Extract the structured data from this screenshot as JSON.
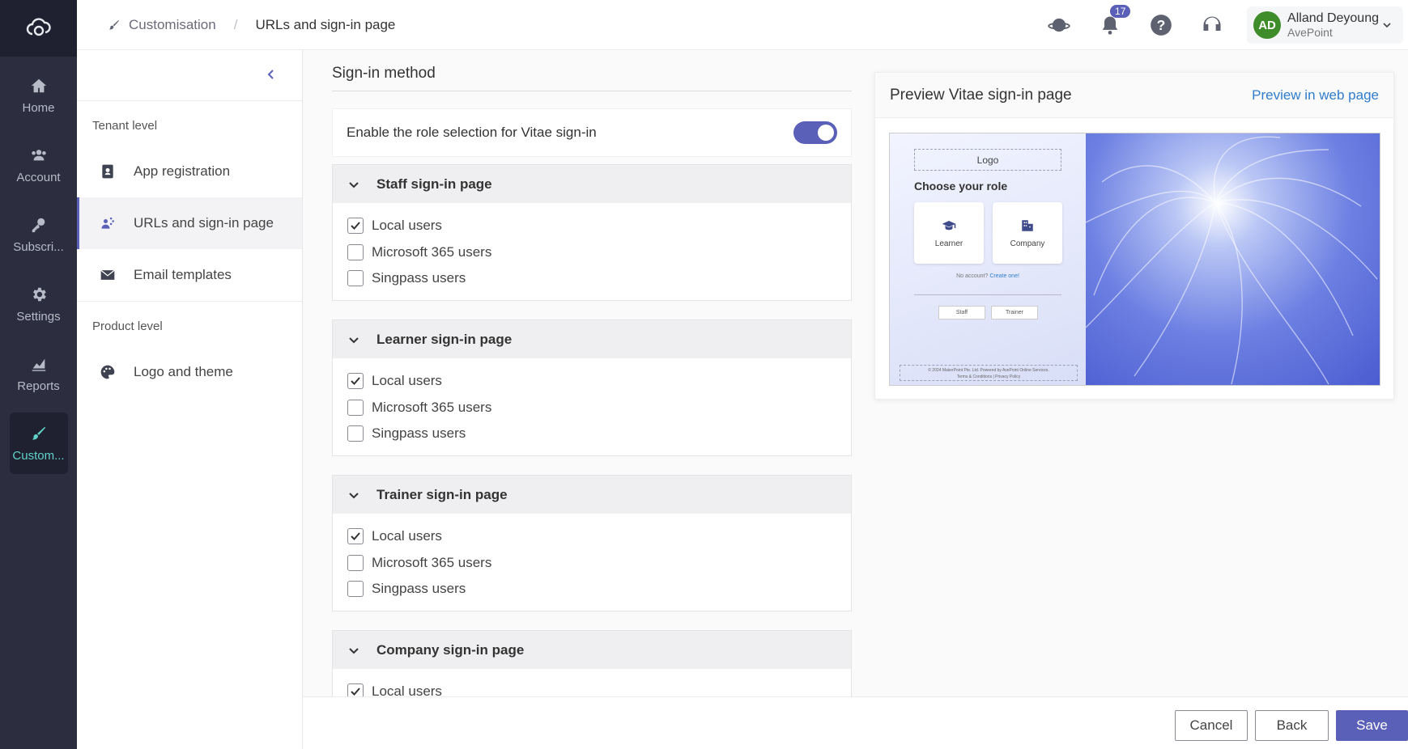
{
  "rail": {
    "items": [
      {
        "label": "Home",
        "icon": "home-icon"
      },
      {
        "label": "Account",
        "icon": "users-icon"
      },
      {
        "label": "Subscri...",
        "icon": "key-icon"
      },
      {
        "label": "Settings",
        "icon": "gear-icon"
      },
      {
        "label": "Reports",
        "icon": "chart-icon"
      },
      {
        "label": "Custom...",
        "icon": "brush-icon",
        "active": true
      }
    ]
  },
  "header": {
    "breadcrumb": [
      "Customisation",
      "URLs and sign-in page"
    ],
    "notification_count": "17",
    "user": {
      "initials": "AD",
      "name": "Alland Deyoung",
      "org": "AvePoint"
    }
  },
  "subnav": {
    "group1_label": "Tenant level",
    "group1_items": [
      "App registration",
      "URLs and sign-in page",
      "Email templates"
    ],
    "group2_label": "Product level",
    "group2_items": [
      "Logo and theme"
    ]
  },
  "main": {
    "section_title": "Sign-in method",
    "toggle_label": "Enable the role selection for Vitae sign-in",
    "toggle_on": true,
    "panels": [
      {
        "title": "Staff sign-in page",
        "options": [
          {
            "label": "Local users",
            "checked": true
          },
          {
            "label": "Microsoft 365 users",
            "checked": false
          },
          {
            "label": "Singpass users",
            "checked": false
          }
        ]
      },
      {
        "title": "Learner sign-in page",
        "options": [
          {
            "label": "Local users",
            "checked": true
          },
          {
            "label": "Microsoft 365 users",
            "checked": false
          },
          {
            "label": "Singpass users",
            "checked": false
          }
        ]
      },
      {
        "title": "Trainer sign-in page",
        "options": [
          {
            "label": "Local users",
            "checked": true
          },
          {
            "label": "Microsoft 365 users",
            "checked": false
          },
          {
            "label": "Singpass users",
            "checked": false
          }
        ]
      },
      {
        "title": "Company sign-in page",
        "options": [
          {
            "label": "Local users",
            "checked": true
          }
        ]
      }
    ]
  },
  "preview": {
    "title": "Preview Vitae sign-in page",
    "link": "Preview in web page",
    "logo_text": "Logo",
    "choose_role": "Choose your role",
    "role_learner": "Learner",
    "role_company": "Company",
    "no_account": "No account?",
    "create_one": "Create one!",
    "btn_staff": "Staff",
    "btn_trainer": "Trainer",
    "footer_line1": "© 2024 MakerPoint Pte. Ltd. Powered by AvePoint Online Services.",
    "footer_line2": "Terms & Conditions | Privacy Policy"
  },
  "footer": {
    "cancel": "Cancel",
    "back": "Back",
    "save": "Save"
  },
  "colors": {
    "accent": "#5a5fb8",
    "rail_bg": "#2c2e3f",
    "rail_active_text": "#5fd3c8",
    "link": "#2f7dcc"
  }
}
